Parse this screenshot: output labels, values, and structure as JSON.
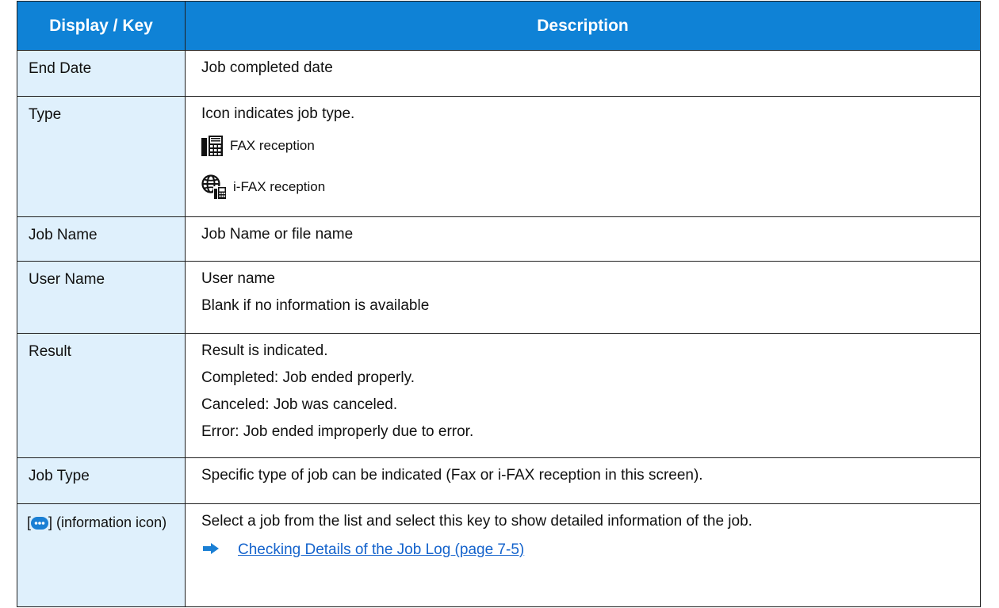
{
  "header": {
    "col_key": "Display / Key",
    "col_desc": "Description"
  },
  "rows": [
    {
      "key": "End Date",
      "desc": [
        "Job completed date"
      ]
    },
    {
      "key": "Type",
      "desc": [
        "Icon indicates job type."
      ],
      "icons": [
        {
          "icon": "fax-icon",
          "label": "FAX reception"
        },
        {
          "icon": "ifax-globe-icon",
          "label": "i-FAX reception"
        }
      ]
    },
    {
      "key": "Job Name",
      "desc": [
        "Job Name or file name"
      ]
    },
    {
      "key": "User Name",
      "desc": [
        "User name",
        "Blank if no information is available"
      ]
    },
    {
      "key": "Result",
      "desc": [
        "Result is indicated.",
        "Completed: Job ended properly.",
        "Canceled: Job was canceled.",
        "Error: Job ended improperly due to error."
      ]
    },
    {
      "key": "Job Type",
      "desc": [
        "Specific type of job can be indicated (Fax or i-FAX reception in this screen)."
      ]
    },
    {
      "key_prefix": "[",
      "key_icon": "information-icon",
      "key_suffix": "] (information icon)",
      "desc": [
        "Select a job from the list and select this key to show detailed information of the job."
      ],
      "link": "Checking Details of the Job Log (page 7-5)"
    }
  ],
  "colors": {
    "header_bg": "#0f82d6",
    "key_bg": "#dff0fc",
    "link": "#1463cc",
    "arrow": "#1a7fd4"
  }
}
